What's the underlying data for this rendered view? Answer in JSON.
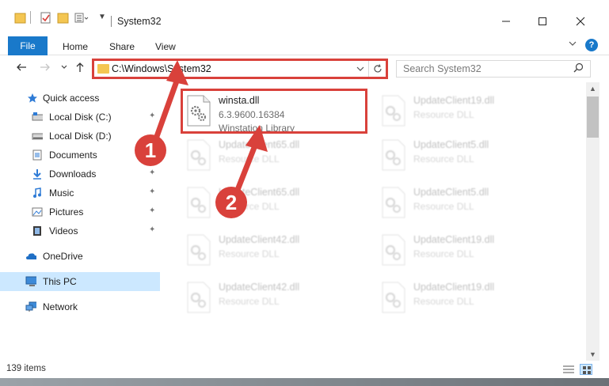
{
  "window": {
    "title": "System32",
    "controls": {
      "minimize": "minimize-icon",
      "maximize": "maximize-icon",
      "close": "close-icon"
    }
  },
  "ribbon": {
    "tabs": [
      {
        "label": "File"
      },
      {
        "label": "Home"
      },
      {
        "label": "Share"
      },
      {
        "label": "View"
      }
    ],
    "help": "?"
  },
  "address": {
    "path": "C:\\Windows\\System32",
    "search_placeholder": "Search System32"
  },
  "sidebar": {
    "items": [
      {
        "label": "Quick access",
        "icon": "star-icon"
      },
      {
        "label": "Local Disk (C:)",
        "icon": "drive-icon",
        "pinned": true
      },
      {
        "label": "Local Disk (D:)",
        "icon": "drive-icon",
        "pinned": false
      },
      {
        "label": "Documents",
        "icon": "documents-icon",
        "pinned": true
      },
      {
        "label": "Downloads",
        "icon": "downloads-icon",
        "pinned": true
      },
      {
        "label": "Music",
        "icon": "music-icon",
        "pinned": true
      },
      {
        "label": "Pictures",
        "icon": "pictures-icon",
        "pinned": true
      },
      {
        "label": "Videos",
        "icon": "videos-icon",
        "pinned": true
      },
      {
        "label": "OneDrive",
        "icon": "onedrive-icon"
      },
      {
        "label": "This PC",
        "icon": "this-pc-icon",
        "selected": true
      },
      {
        "label": "Network",
        "icon": "network-icon"
      }
    ]
  },
  "files": [
    {
      "name": "winsta.dll",
      "version": "6.3.9600.16384",
      "description": "Winstation Library",
      "faded": false
    },
    {
      "name": "UpdateClient19.dll",
      "description": "Resource DLL",
      "faded": true
    },
    {
      "name": "UpdateClient65.dll",
      "description": "Resource DLL",
      "faded": true
    },
    {
      "name": "UpdateClient5.dll",
      "description": "Resource DLL",
      "faded": true
    },
    {
      "name": "UpdateClient65.dll",
      "description": "Resource DLL",
      "faded": true
    },
    {
      "name": "UpdateClient5.dll",
      "description": "Resource DLL",
      "faded": true
    },
    {
      "name": "UpdateClient42.dll",
      "description": "Resource DLL",
      "faded": true
    },
    {
      "name": "UpdateClient19.dll",
      "description": "Resource DLL",
      "faded": true
    },
    {
      "name": "UpdateClient42.dll",
      "description": "Resource DLL",
      "faded": true
    },
    {
      "name": "UpdateClient19.dll",
      "description": "Resource DLL",
      "faded": true
    }
  ],
  "status": {
    "item_count": "139 items"
  },
  "annotations": {
    "step1": "1",
    "step2": "2"
  },
  "colors": {
    "accent": "#1979ca",
    "annotation": "#d9413b",
    "selected": "#cce8ff"
  }
}
